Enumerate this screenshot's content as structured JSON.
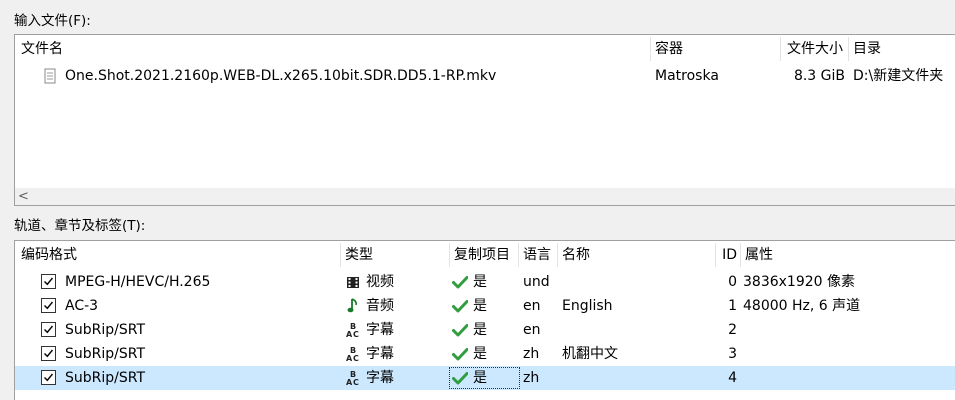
{
  "input_files": {
    "section_label": "输入文件(F):",
    "columns": {
      "name": "文件名",
      "container": "容器",
      "size": "文件大小",
      "dir": "目录"
    },
    "files": [
      {
        "name": "One.Shot.2021.2160p.WEB-DL.x265.10bit.SDR.DD5.1-RP.mkv",
        "container": "Matroska",
        "size": "8.3 GiB",
        "dir": "D:\\新建文件夹"
      }
    ],
    "scroll_left_glyph": "<"
  },
  "tracks": {
    "section_label": "轨道、章节及标签(T):",
    "columns": {
      "codec": "编码格式",
      "type": "类型",
      "copy": "复制项目",
      "lang": "语言",
      "name": "名称",
      "id": "ID",
      "props": "属性"
    },
    "rows": [
      {
        "codec": "MPEG-H/HEVC/H.265",
        "type_icon": "film-icon",
        "type": "视频",
        "copy": "是",
        "lang": "und",
        "name": "",
        "id": "0",
        "props": "3836x1920 像素",
        "checked": true,
        "selected": false
      },
      {
        "codec": "AC-3",
        "type_icon": "music-note-icon",
        "type": "音频",
        "copy": "是",
        "lang": "en",
        "name": "English",
        "id": "1",
        "props": "48000 Hz, 6 声道",
        "checked": true,
        "selected": false
      },
      {
        "codec": "SubRip/SRT",
        "type_icon": "subtitle-icon",
        "type": "字幕",
        "copy": "是",
        "lang": "en",
        "name": "",
        "id": "2",
        "props": "",
        "checked": true,
        "selected": false
      },
      {
        "codec": "SubRip/SRT",
        "type_icon": "subtitle-icon",
        "type": "字幕",
        "copy": "是",
        "lang": "zh",
        "name": "机翻中文",
        "id": "3",
        "props": "",
        "checked": true,
        "selected": false
      },
      {
        "codec": "SubRip/SRT",
        "type_icon": "subtitle-icon",
        "type": "字幕",
        "copy": "是",
        "lang": "zh",
        "name": "",
        "id": "4",
        "props": "",
        "checked": true,
        "selected": true
      }
    ]
  },
  "colors": {
    "selection": "#cce8ff",
    "check_green": "#2e9e3e",
    "border": "#a0a0a0"
  }
}
